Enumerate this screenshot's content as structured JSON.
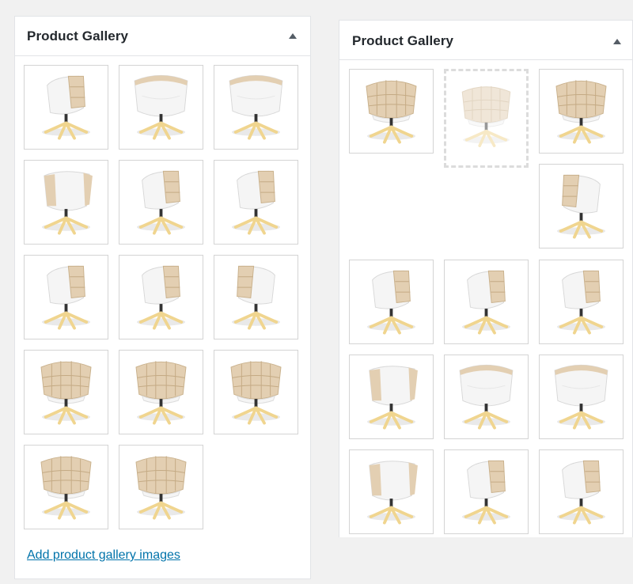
{
  "left_panel": {
    "title": "Product Gallery",
    "add_link": "Add product gallery images",
    "images": [
      {
        "view": "side-left"
      },
      {
        "view": "back"
      },
      {
        "view": "back"
      },
      {
        "view": "back-left"
      },
      {
        "view": "side-left"
      },
      {
        "view": "side-left"
      },
      {
        "view": "side-left"
      },
      {
        "view": "side-left"
      },
      {
        "view": "side-right"
      },
      {
        "view": "front"
      },
      {
        "view": "front"
      },
      {
        "view": "front"
      },
      {
        "view": "front"
      },
      {
        "view": "front"
      }
    ]
  },
  "right_panel": {
    "title": "Product Gallery",
    "dragging_image": {
      "view": "front"
    },
    "images": [
      {
        "view": "front"
      },
      {
        "view": "front"
      },
      {
        "view": "side-right"
      },
      {
        "view": "side-left"
      },
      {
        "view": "side-left"
      },
      {
        "view": "side-left"
      },
      {
        "view": "back-left"
      },
      {
        "view": "back"
      },
      {
        "view": "back"
      },
      {
        "view": "back-left"
      },
      {
        "view": "side-left"
      },
      {
        "view": "side-left"
      }
    ]
  },
  "colors": {
    "link": "#0073aa",
    "title": "#23282d",
    "cushion": "#e3cfb2",
    "shell": "#f5f5f5",
    "legs": "#f0d58f"
  }
}
